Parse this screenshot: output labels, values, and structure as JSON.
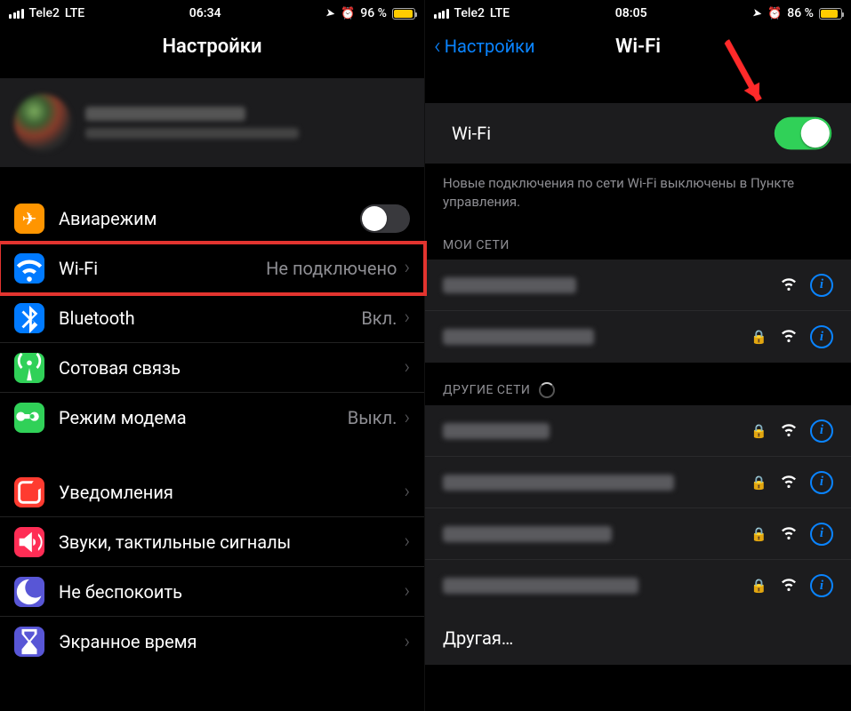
{
  "left": {
    "status": {
      "carrier": "Tele2",
      "net": "LTE",
      "time": "06:34",
      "batteryText": "96 %",
      "batteryLevel": 96,
      "batteryColor": "#ffcc00"
    },
    "title": "Настройки",
    "group1": {
      "airplane": {
        "label": "Авиарежим",
        "iconColor": "#ff9500",
        "on": false
      },
      "wifi": {
        "label": "Wi-Fi",
        "value": "Не подключено",
        "iconColor": "#007aff"
      },
      "bluetooth": {
        "label": "Bluetooth",
        "value": "Вкл.",
        "iconColor": "#007aff"
      },
      "cellular": {
        "label": "Сотовая связь",
        "iconColor": "#30d158"
      },
      "hotspot": {
        "label": "Режим модема",
        "value": "Выкл.",
        "iconColor": "#30d158"
      }
    },
    "group2": {
      "notifications": {
        "label": "Уведомления",
        "iconColor": "#ff3b30"
      },
      "sounds": {
        "label": "Звуки, тактильные сигналы",
        "iconColor": "#ff2d55"
      },
      "dnd": {
        "label": "Не беспокоить",
        "iconColor": "#5856d6"
      },
      "screentime": {
        "label": "Экранное время",
        "iconColor": "#5856d6"
      }
    }
  },
  "right": {
    "status": {
      "carrier": "Tele2",
      "net": "LTE",
      "time": "08:05",
      "batteryText": "86 %",
      "batteryLevel": 86,
      "batteryColor": "#ffcc00"
    },
    "back": "Настройки",
    "title": "Wi-Fi",
    "wifiLabel": "Wi-Fi",
    "wifiOn": true,
    "note": "Новые подключения по сети Wi-Fi выключены в Пункте управления.",
    "myNetworksHeader": "МОИ СЕТИ",
    "otherNetworksHeader": "ДРУГИЕ СЕТИ",
    "otherLabel": "Другая…",
    "infoGlyph": "i"
  }
}
